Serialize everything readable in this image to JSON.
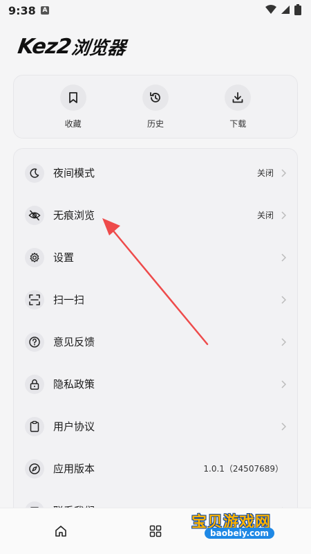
{
  "status_bar": {
    "time": "9:38",
    "badge": "A"
  },
  "logo": {
    "brand": "Kez2",
    "suffix": "浏览器"
  },
  "quick_actions": [
    {
      "label": "收藏",
      "icon": "bookmark-icon"
    },
    {
      "label": "历史",
      "icon": "history-icon"
    },
    {
      "label": "下载",
      "icon": "download-icon"
    }
  ],
  "menu": [
    {
      "title": "夜间模式",
      "value": "关闭",
      "icon": "moon-icon"
    },
    {
      "title": "无痕浏览",
      "value": "关闭",
      "icon": "eye-off-icon"
    },
    {
      "title": "设置",
      "value": "",
      "icon": "gear-icon"
    },
    {
      "title": "扫一扫",
      "value": "",
      "icon": "scan-icon"
    },
    {
      "title": "意见反馈",
      "value": "",
      "icon": "question-icon"
    },
    {
      "title": "隐私政策",
      "value": "",
      "icon": "lock-icon"
    },
    {
      "title": "用户协议",
      "value": "",
      "icon": "clipboard-icon"
    },
    {
      "title": "应用版本",
      "value": "1.0.1（24507689）",
      "icon": "compass-icon"
    },
    {
      "title": "联系我们",
      "value": "",
      "icon": "contact-icon"
    }
  ],
  "bottom_nav": [
    {
      "icon": "home-icon"
    },
    {
      "icon": "grid-icon"
    },
    {
      "icon": "cloud-icon"
    }
  ],
  "watermark": {
    "text": "宝贝游戏网",
    "url": "baobeiy.com"
  },
  "colors": {
    "arrow": "#ee4b4b",
    "background": "#f5f5f6",
    "card": "#f2f2f4"
  }
}
